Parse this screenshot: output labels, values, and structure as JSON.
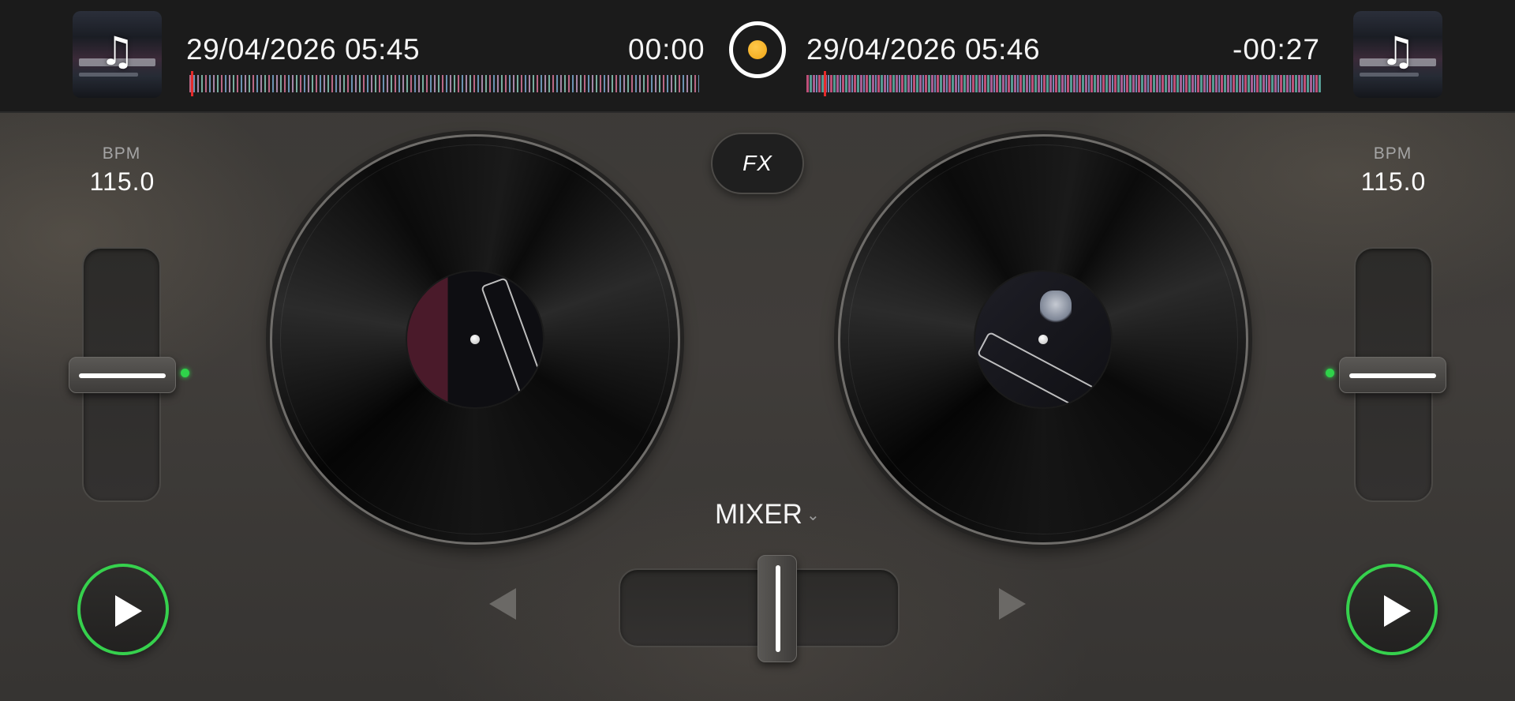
{
  "deck_a": {
    "title": "29/04/2026 05:45",
    "time": "00:00",
    "bpm_label": "BPM",
    "bpm": "115.0",
    "artwork_icon": "music-note-icon",
    "pitch_fraction": 0.5
  },
  "deck_b": {
    "title": "29/04/2026 05:46",
    "time": "-00:27",
    "bpm_label": "BPM",
    "bpm": "115.0",
    "artwork_icon": "music-note-icon",
    "pitch_fraction": 0.5
  },
  "center": {
    "fx_label": "FX",
    "mixer_label": "MIXER",
    "crossfader_fraction": 0.5
  },
  "icons": {
    "note_glyph": "♫",
    "chevron_glyph": "⌄"
  },
  "colors": {
    "accent_green": "#36d14d",
    "sync_orange": "#f0a516",
    "playhead_red": "#e52b2b"
  }
}
